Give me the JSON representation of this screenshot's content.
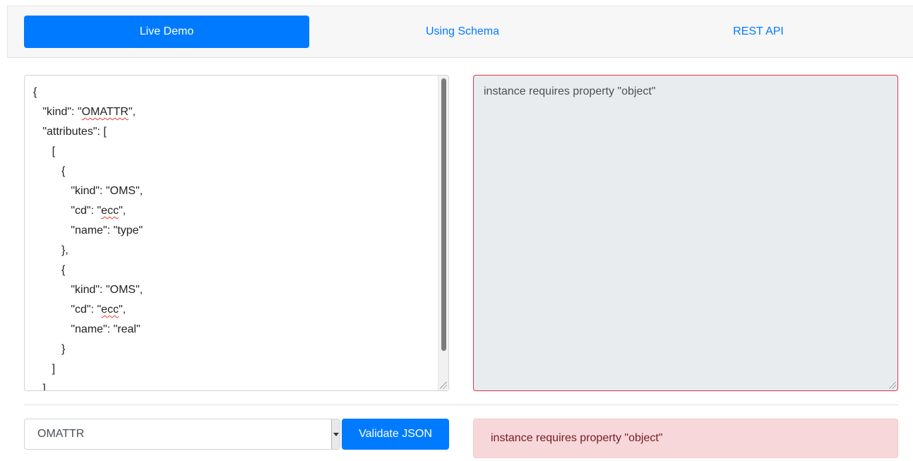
{
  "nav": {
    "tabs": [
      {
        "label": "Live Demo",
        "active": true
      },
      {
        "label": "Using Schema",
        "active": false
      },
      {
        "label": "REST API",
        "active": false
      }
    ]
  },
  "editor": {
    "lines": [
      "{",
      "   \"kind\": \"OMATTR\",",
      "   \"attributes\": [",
      "      [",
      "         {",
      "            \"kind\": \"OMS\",",
      "            \"cd\": \"ecc\",",
      "            \"name\": \"type\"",
      "         },",
      "         {",
      "            \"kind\": \"OMS\",",
      "            \"cd\": \"ecc\",",
      "            \"name\": \"real\"",
      "         }",
      "      ]",
      "   ]"
    ]
  },
  "output": {
    "text": "instance requires property \"object\"",
    "border_color": "#dc3545"
  },
  "controls": {
    "select_value": "OMATTR",
    "validate_label": "Validate JSON"
  },
  "alert": {
    "text": "instance requires property \"object\""
  },
  "colors": {
    "accent": "#007bff",
    "error": "#dc3545",
    "alert_bg": "#f8d7da"
  }
}
